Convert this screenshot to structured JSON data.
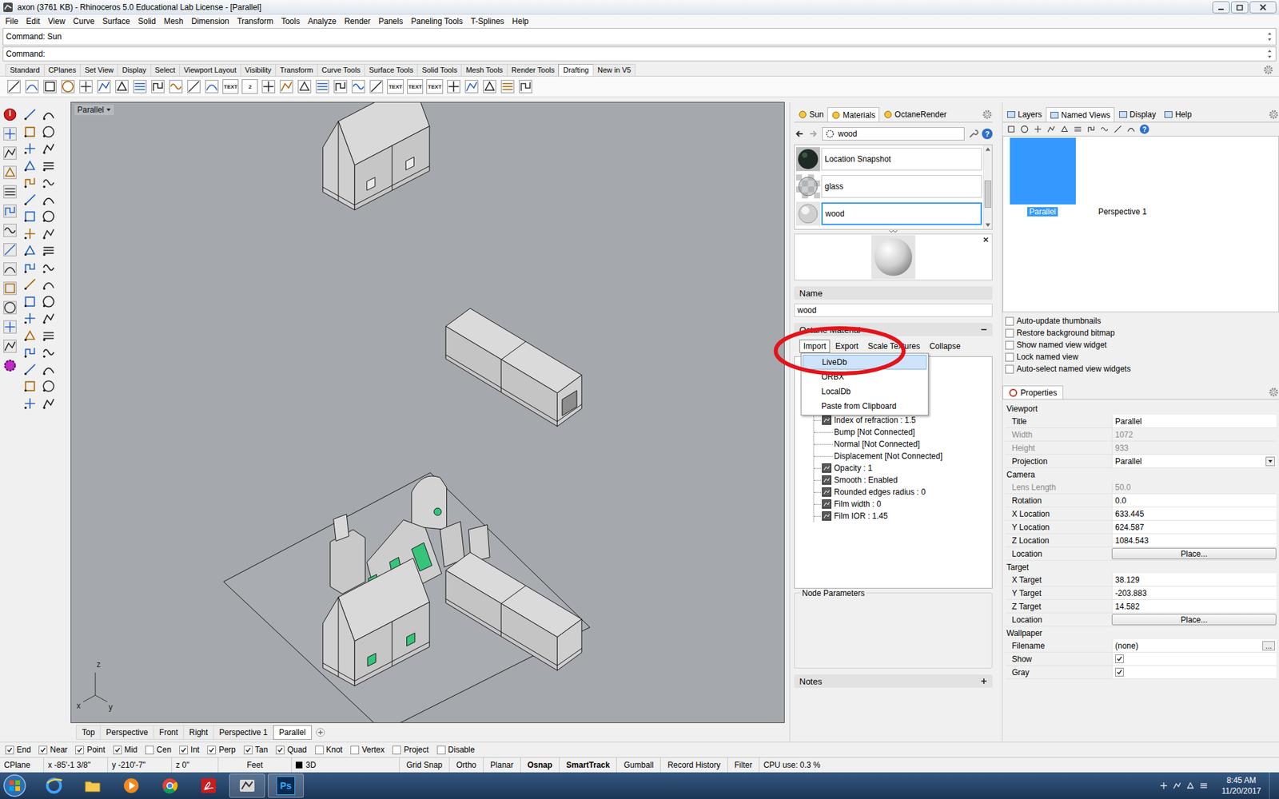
{
  "window": {
    "title": "axon (3761 KB) - Rhinoceros 5.0 Educational Lab License - [Parallel]"
  },
  "menu": [
    "File",
    "Edit",
    "View",
    "Curve",
    "Surface",
    "Solid",
    "Mesh",
    "Dimension",
    "Transform",
    "Tools",
    "Analyze",
    "Render",
    "Panels",
    "Paneling Tools",
    "T-Splines",
    "Help"
  ],
  "command": {
    "history": "Command: Sun",
    "prompt": "Command:"
  },
  "toolbar_tabs": [
    {
      "label": "Standard",
      "selected": false
    },
    {
      "label": "CPlanes",
      "selected": false
    },
    {
      "label": "Set View",
      "selected": false
    },
    {
      "label": "Display",
      "selected": false
    },
    {
      "label": "Select",
      "selected": false
    },
    {
      "label": "Viewport Layout",
      "selected": false
    },
    {
      "label": "Visibility",
      "selected": false
    },
    {
      "label": "Transform",
      "selected": false
    },
    {
      "label": "Curve Tools",
      "selected": false
    },
    {
      "label": "Surface Tools",
      "selected": false
    },
    {
      "label": "Solid Tools",
      "selected": false
    },
    {
      "label": "Mesh Tools",
      "selected": false
    },
    {
      "label": "Render Tools",
      "selected": false
    },
    {
      "label": "Drafting",
      "selected": true
    },
    {
      "label": "New in V5",
      "selected": false
    }
  ],
  "toolbar_icons": [
    {
      "kind": "glyph"
    },
    {
      "kind": "glyph"
    },
    {
      "kind": "glyph"
    },
    {
      "kind": "glyph"
    },
    {
      "kind": "glyph"
    },
    {
      "kind": "glyph"
    },
    {
      "kind": "glyph"
    },
    {
      "kind": "glyph"
    },
    {
      "kind": "glyph"
    },
    {
      "kind": "glyph"
    },
    {
      "kind": "glyph"
    },
    {
      "kind": "glyph"
    },
    {
      "kind": "text",
      "text": "TEXT"
    },
    {
      "kind": "text",
      "text": "2"
    },
    {
      "kind": "glyph"
    },
    {
      "kind": "glyph"
    },
    {
      "kind": "glyph"
    },
    {
      "kind": "glyph"
    },
    {
      "kind": "glyph"
    },
    {
      "kind": "glyph"
    },
    {
      "kind": "glyph"
    },
    {
      "kind": "text",
      "text": "TEXT"
    },
    {
      "kind": "text",
      "text": "TEXT"
    },
    {
      "kind": "text",
      "text": "TEXT"
    },
    {
      "kind": "glyph"
    },
    {
      "kind": "glyph"
    },
    {
      "kind": "glyph"
    },
    {
      "kind": "glyph"
    },
    {
      "kind": "glyph"
    }
  ],
  "viewport": {
    "label": "Parallel",
    "axes": {
      "z": "z",
      "x": "x",
      "y": "y"
    }
  },
  "viewport_tabs": [
    {
      "label": "Top",
      "selected": false
    },
    {
      "label": "Perspective",
      "selected": false
    },
    {
      "label": "Front",
      "selected": false
    },
    {
      "label": "Right",
      "selected": false
    },
    {
      "label": "Perspective 1",
      "selected": false
    },
    {
      "label": "Parallel",
      "selected": true
    }
  ],
  "materials_panel": {
    "tabs": [
      {
        "label": "Sun",
        "selected": false
      },
      {
        "label": "Materials",
        "selected": true
      },
      {
        "label": "OctaneRender",
        "selected": false
      }
    ],
    "search": "wood",
    "help": "?",
    "materials": [
      {
        "name": "Location Snapshot",
        "kind": "environment",
        "selected": false
      },
      {
        "name": "glass",
        "kind": "glass",
        "selected": false
      },
      {
        "name": "wood",
        "kind": "plain",
        "selected": true
      }
    ],
    "name_header": "Name",
    "name_value": "wood",
    "section_title": "Octane Material",
    "buttons": [
      {
        "label": "Import",
        "pressed": true
      },
      {
        "label": "Export",
        "pressed": false
      },
      {
        "label": "Scale Textures",
        "pressed": false
      },
      {
        "label": "Collapse",
        "pressed": false
      }
    ],
    "tree": [
      {
        "text": "Index of refraction : 1.5",
        "kind": "param"
      },
      {
        "text": "Bump [Not Connected]",
        "kind": "link"
      },
      {
        "text": "Normal [Not Connected]",
        "kind": "link"
      },
      {
        "text": "Displacement [Not Connected]",
        "kind": "link"
      },
      {
        "text": "Opacity : 1",
        "kind": "param"
      },
      {
        "text": "Smooth : Enabled",
        "kind": "param"
      },
      {
        "text": "Rounded edges radius : 0",
        "kind": "param"
      },
      {
        "text": "Film width : 0",
        "kind": "param"
      },
      {
        "text": "Film IOR : 1.45",
        "kind": "param"
      }
    ],
    "node_parameters": "Node Parameters",
    "notes": "Notes"
  },
  "import_menu": [
    {
      "label": "LiveDb",
      "selected": true
    },
    {
      "label": "ORBX",
      "selected": false
    },
    {
      "label": "LocalDb",
      "selected": false
    },
    {
      "label": "Paste from Clipboard",
      "selected": false
    }
  ],
  "views_panel": {
    "tabs": [
      {
        "label": "Layers",
        "selected": false
      },
      {
        "label": "Named Views",
        "selected": true
      },
      {
        "label": "Display",
        "selected": false
      },
      {
        "label": "Help",
        "selected": false
      }
    ],
    "help": "?",
    "views": [
      {
        "name": "Parallel",
        "selected": true
      },
      {
        "name": "Perspective 1",
        "selected": false
      }
    ],
    "options": [
      {
        "label": "Auto-update thumbnails",
        "checked": false
      },
      {
        "label": "Restore background bitmap",
        "checked": false
      },
      {
        "label": "Show named view widget",
        "checked": false
      },
      {
        "label": "Lock named view",
        "checked": false
      },
      {
        "label": "Auto-select named view widgets",
        "checked": false
      }
    ]
  },
  "properties": {
    "title": "Properties",
    "sections": [
      {
        "title": "Viewport",
        "rows": [
          {
            "label": "Title",
            "value": "Parallel",
            "kind": "text",
            "disabled": false
          },
          {
            "label": "Width",
            "value": "1072",
            "kind": "text",
            "disabled": true
          },
          {
            "label": "Height",
            "value": "933",
            "kind": "text",
            "disabled": true
          },
          {
            "label": "Projection",
            "value": "Parallel",
            "kind": "dropdown",
            "disabled": false
          }
        ]
      },
      {
        "title": "Camera",
        "rows": [
          {
            "label": "Lens Length",
            "value": "50.0",
            "kind": "text",
            "disabled": true
          },
          {
            "label": "Rotation",
            "value": "0.0",
            "kind": "text",
            "disabled": false
          },
          {
            "label": "X Location",
            "value": "633.445",
            "kind": "text",
            "disabled": false
          },
          {
            "label": "Y Location",
            "value": "624.587",
            "kind": "text",
            "disabled": false
          },
          {
            "label": "Z Location",
            "value": "1084.543",
            "kind": "text",
            "disabled": false
          },
          {
            "label": "Location",
            "value": "Place...",
            "kind": "button",
            "disabled": false
          }
        ]
      },
      {
        "title": "Target",
        "rows": [
          {
            "label": "X Target",
            "value": "38.129",
            "kind": "text",
            "disabled": false
          },
          {
            "label": "Y Target",
            "value": "-203.883",
            "kind": "text",
            "disabled": false
          },
          {
            "label": "Z Target",
            "value": "14.582",
            "kind": "text",
            "disabled": false
          },
          {
            "label": "Location",
            "value": "Place...",
            "kind": "button",
            "disabled": false
          }
        ]
      },
      {
        "title": "Wallpaper",
        "rows": [
          {
            "label": "Filename",
            "value": "(none)",
            "kind": "file",
            "button": "...",
            "disabled": false
          },
          {
            "label": "Show",
            "kind": "check",
            "checked": true,
            "disabled": false
          },
          {
            "label": "Gray",
            "kind": "check",
            "checked": true,
            "disabled": false
          }
        ]
      }
    ]
  },
  "osnap": [
    {
      "label": "End",
      "checked": true
    },
    {
      "label": "Near",
      "checked": true
    },
    {
      "label": "Point",
      "checked": true
    },
    {
      "label": "Mid",
      "checked": true
    },
    {
      "label": "Cen",
      "checked": false
    },
    {
      "label": "Int",
      "checked": true
    },
    {
      "label": "Perp",
      "checked": true
    },
    {
      "label": "Tan",
      "checked": true
    },
    {
      "label": "Quad",
      "checked": true
    },
    {
      "label": "Knot",
      "checked": false
    },
    {
      "label": "Vertex",
      "checked": false
    },
    {
      "label": "Project",
      "checked": false
    },
    {
      "label": "Disable",
      "checked": false
    }
  ],
  "status_bar": {
    "cplane": "CPlane",
    "x": "x -85'-1 3/8\"",
    "y": "y -210'-7\"",
    "z": "z 0\"",
    "units": "Feet",
    "layer": "3D",
    "panes": [
      {
        "label": "Grid Snap",
        "on": false
      },
      {
        "label": "Ortho",
        "on": false
      },
      {
        "label": "Planar",
        "on": false
      },
      {
        "label": "Osnap",
        "on": true
      },
      {
        "label": "SmartTrack",
        "on": true
      },
      {
        "label": "Gumball",
        "on": false
      },
      {
        "label": "Record History",
        "on": false
      },
      {
        "label": "Filter",
        "on": false
      }
    ],
    "cpu": "CPU use: 0.3 %"
  },
  "taskbar": {
    "apps": [
      {
        "kind": "ie",
        "active": false
      },
      {
        "kind": "folder",
        "active": false
      },
      {
        "kind": "media",
        "active": false
      },
      {
        "kind": "chrome",
        "active": false
      },
      {
        "kind": "acrobat",
        "active": false
      },
      {
        "kind": "rhino",
        "active": true
      },
      {
        "kind": "photoshop",
        "text": "Ps",
        "active": true
      }
    ],
    "time": "8:45 AM",
    "date": "11/20/2017"
  }
}
